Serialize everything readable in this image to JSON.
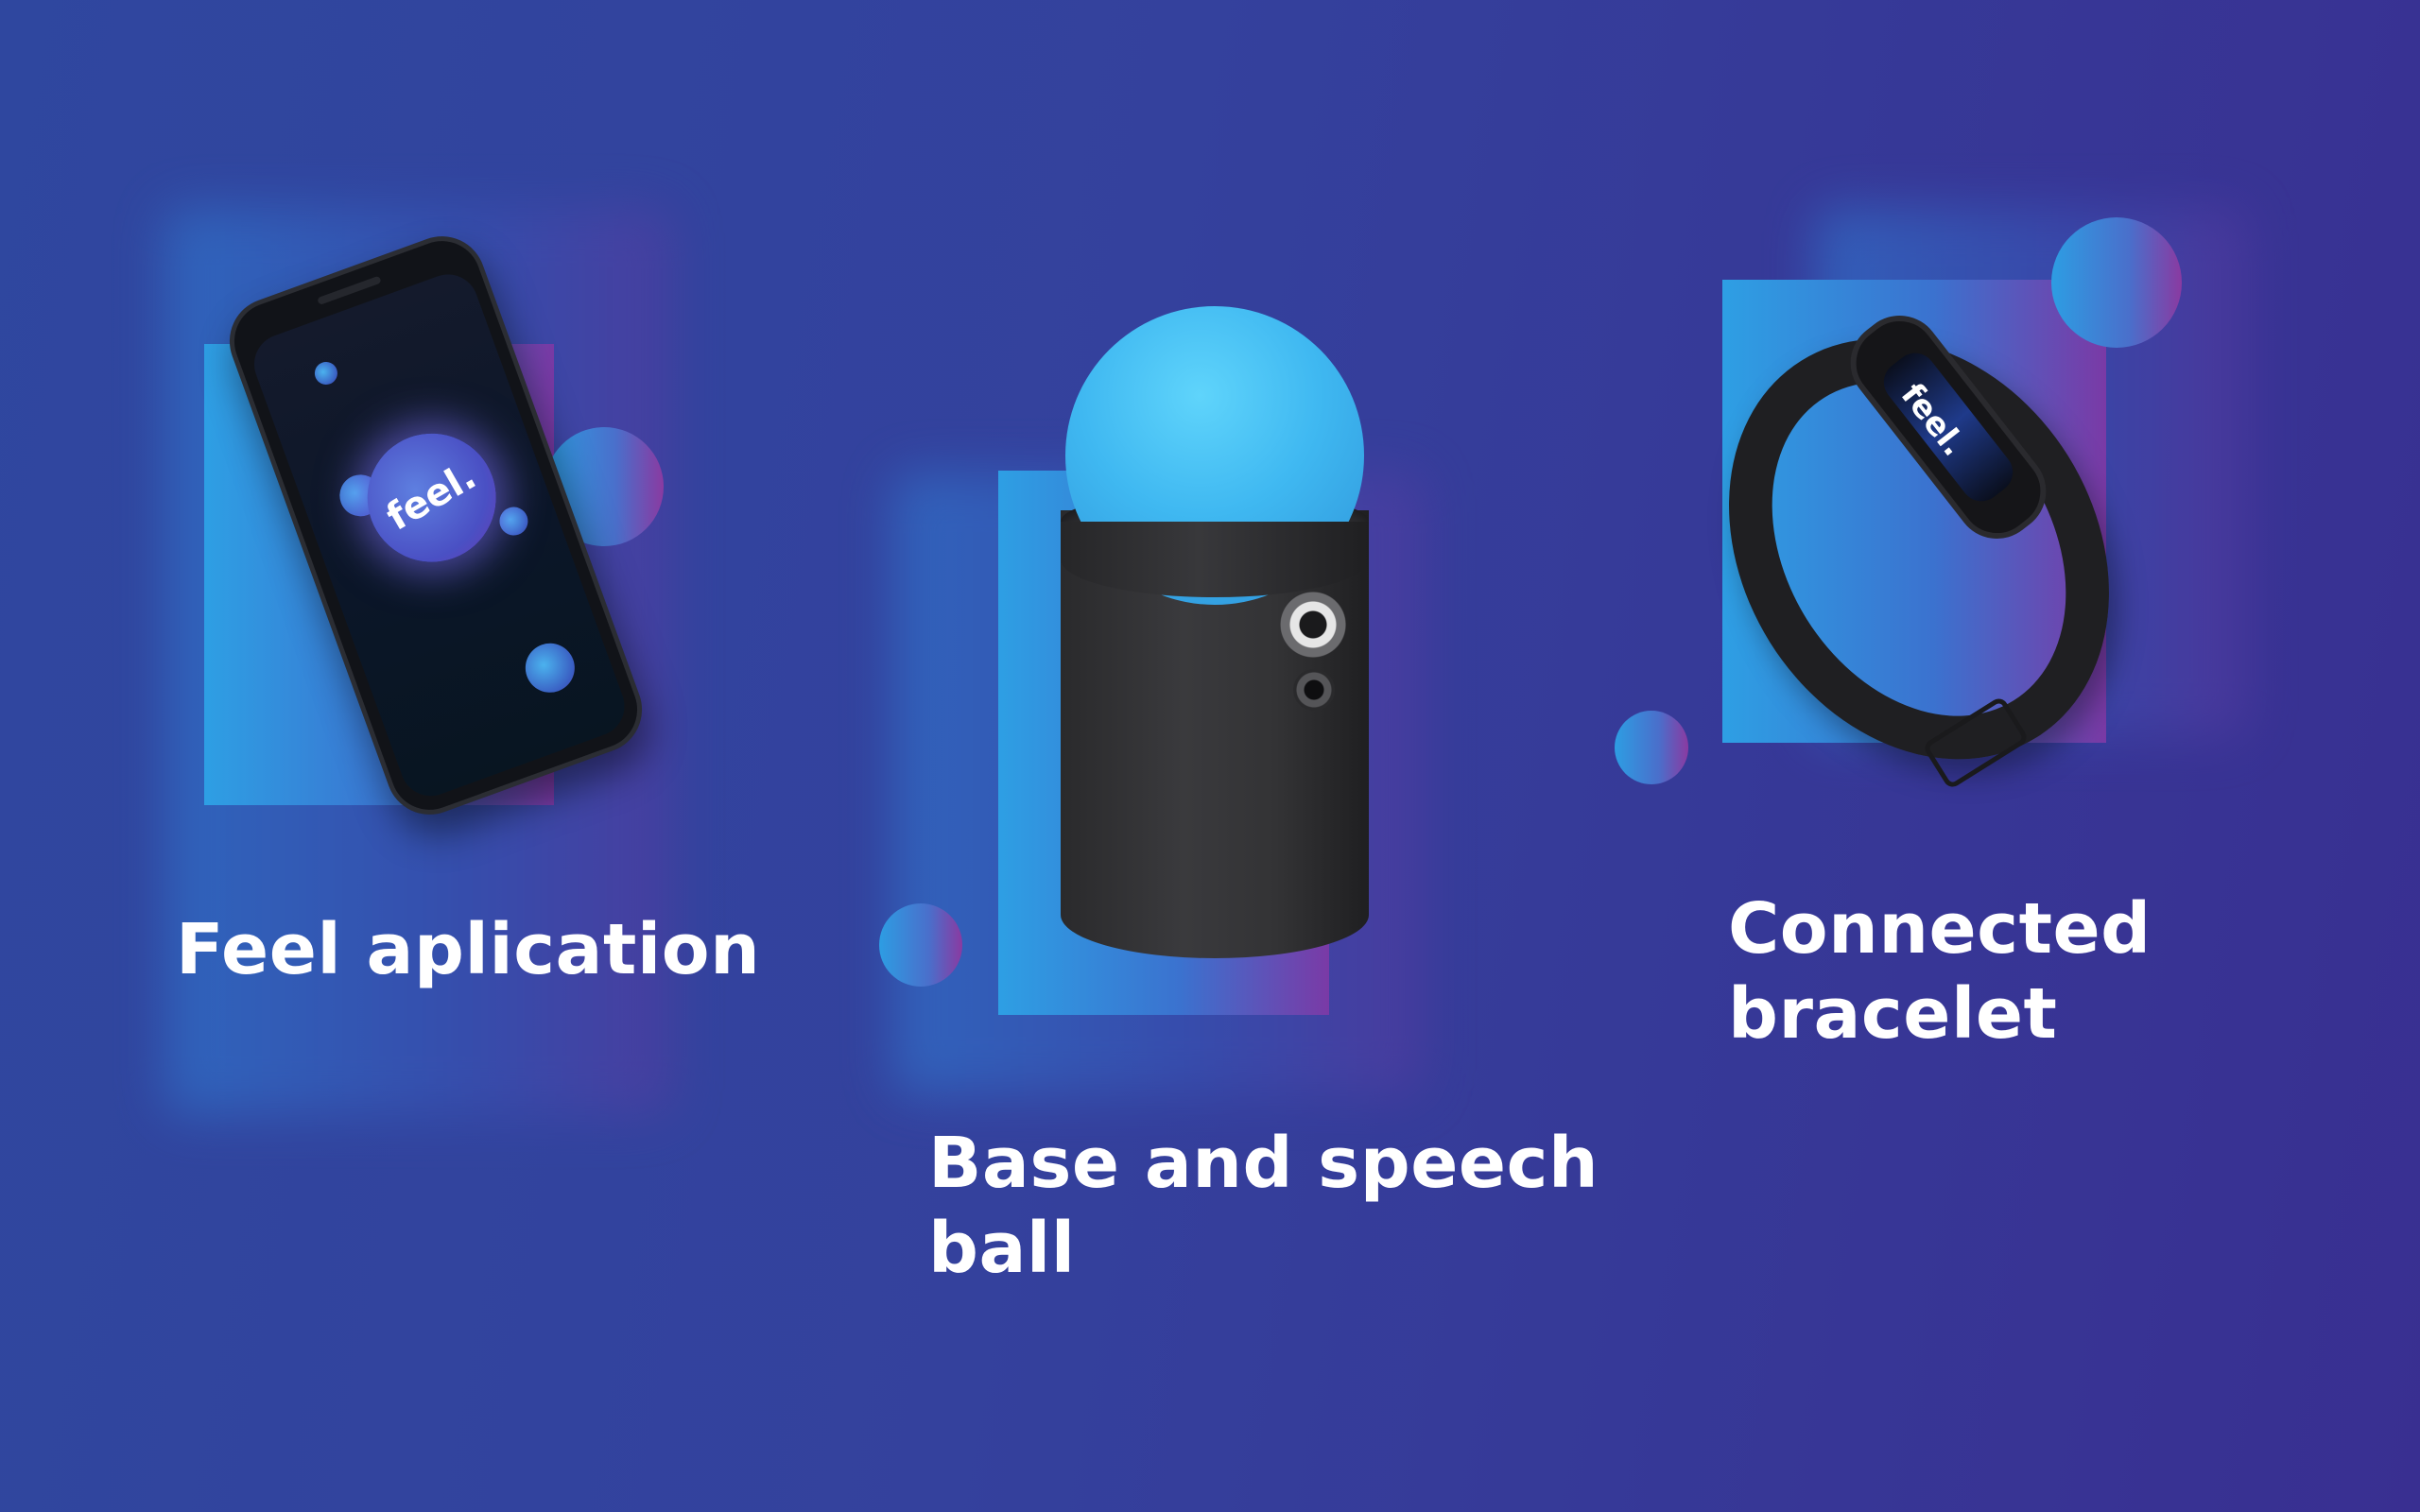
{
  "products": [
    {
      "title_lines": [
        "Feel aplication"
      ],
      "screen_logo": "feel."
    },
    {
      "title_lines": [
        "Base and speech",
        "ball"
      ]
    },
    {
      "title_lines": [
        "Connected",
        "bracelet"
      ],
      "screen_logo": "feel."
    }
  ],
  "colors": {
    "background_start": "#2f479f",
    "background_end": "#392f91",
    "accent_blue": "#2e9fe4",
    "accent_purple": "#7a3aa6",
    "ball_blue": "#3fb8f1",
    "device_black": "#1f1f22",
    "text": "#ffffff"
  },
  "icons": [
    "phone-image",
    "speech-ball-image",
    "bracelet-image"
  ]
}
